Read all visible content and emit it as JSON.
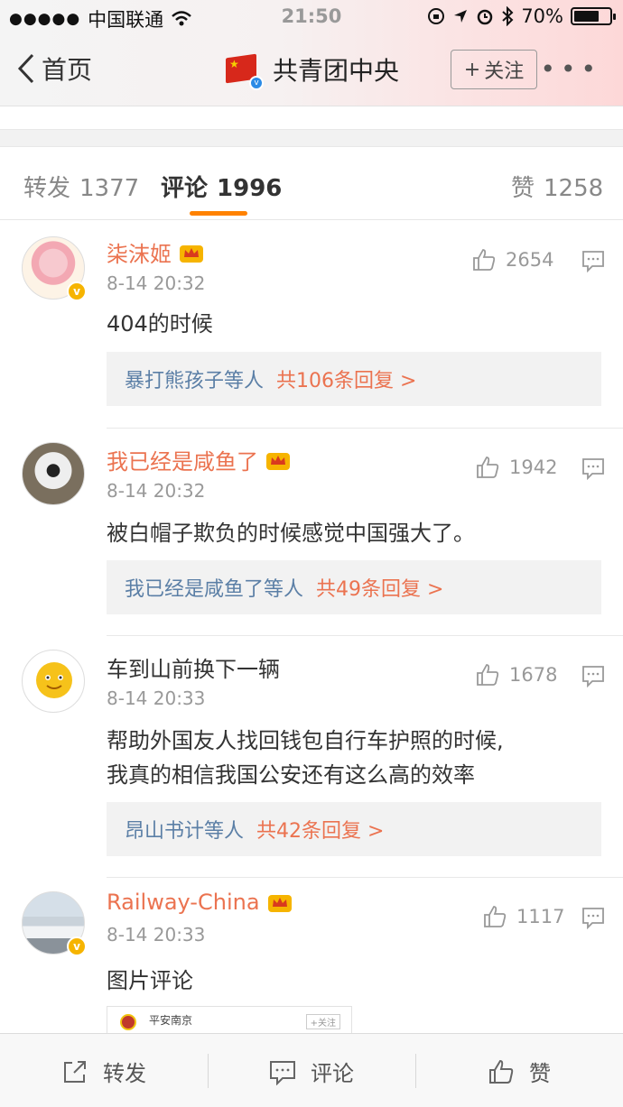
{
  "status_bar": {
    "carrier": "中国联通",
    "time": "21:50",
    "battery": "70%",
    "battery_level": 0.7
  },
  "nav": {
    "back_label": "首页",
    "title": "共青团中央",
    "follow_label": "关注",
    "more_label": "•••"
  },
  "tabs": [
    {
      "label": "转发",
      "count": "1377"
    },
    {
      "label": "评论",
      "count": "1996"
    },
    {
      "label": "赞",
      "count": "1258"
    }
  ],
  "comments": [
    {
      "name": "柒沫姬",
      "time": "8-14 20:32",
      "likes": "2654",
      "text": "404的时候",
      "replies_users": "暴打熊孩子等人",
      "replies_count": "共106条回复 >"
    },
    {
      "name": "我已经是咸鱼了",
      "time": "8-14 20:32",
      "likes": "1942",
      "text": "被白帽子欺负的时候感觉中国强大了。",
      "replies_users": "我已经是咸鱼了等人",
      "replies_count": "共49条回复 >"
    },
    {
      "name": "车到山前换下一辆",
      "time": "8-14 20:33",
      "likes": "1678",
      "text_line1": "帮助外国友人找回钱包自行车护照的时候,",
      "text_line2": "我真的相信我国公安还有这么高的效率",
      "replies_users": "昂山书计等人",
      "replies_count": "共42条回复 >"
    },
    {
      "name": "Railway-China",
      "time": "8-14 20:33",
      "likes": "1117",
      "text": "图片评论",
      "image_title": "平安南京",
      "image_follow": "+关注"
    }
  ],
  "bottom_bar": {
    "repost": "转发",
    "comment": "评论",
    "like": "赞"
  },
  "colors": {
    "accent": "#ff8200",
    "vip_name": "#eb7350",
    "link": "#5b7fa6"
  }
}
